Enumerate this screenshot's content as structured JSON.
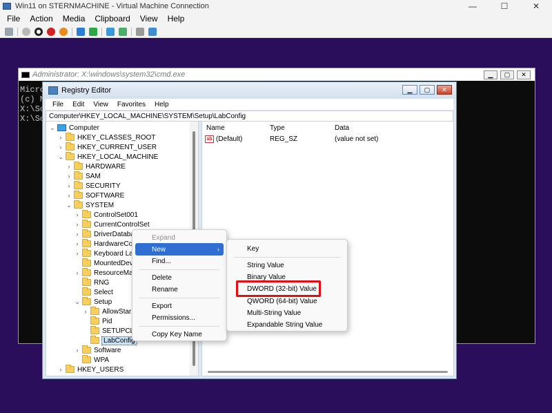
{
  "host": {
    "title": "Win11 on STERNMACHINE - Virtual Machine Connection",
    "menu": [
      "File",
      "Action",
      "Media",
      "Clipboard",
      "View",
      "Help"
    ],
    "window_buttons": [
      "—",
      "☐",
      "✕"
    ]
  },
  "cmd": {
    "title": "Administrator: X:\\windows\\system32\\cmd.exe",
    "lines": [
      "Micro",
      "(c) M",
      "",
      "X:\\So",
      "",
      "X:\\So"
    ]
  },
  "regedit": {
    "title": "Registry Editor",
    "menu": [
      "File",
      "Edit",
      "View",
      "Favorites",
      "Help"
    ],
    "address": "Computer\\HKEY_LOCAL_MACHINE\\SYSTEM\\Setup\\LabConfig",
    "tree": [
      {
        "arrow": "⌄",
        "label": "Computer",
        "icon": "pc"
      },
      {
        "arrow": "›",
        "label": "HKEY_CLASSES_ROOT",
        "icon": "folder"
      },
      {
        "arrow": "›",
        "label": "HKEY_CURRENT_USER",
        "icon": "folder"
      },
      {
        "arrow": "⌄",
        "label": "HKEY_LOCAL_MACHINE",
        "icon": "folder"
      },
      {
        "arrow": "›",
        "label": "HARDWARE",
        "icon": "folder"
      },
      {
        "arrow": "›",
        "label": "SAM",
        "icon": "folder"
      },
      {
        "arrow": "›",
        "label": "SECURITY",
        "icon": "folder"
      },
      {
        "arrow": "›",
        "label": "SOFTWARE",
        "icon": "folder"
      },
      {
        "arrow": "⌄",
        "label": "SYSTEM",
        "icon": "folder"
      },
      {
        "arrow": "›",
        "label": "ControlSet001",
        "icon": "folder"
      },
      {
        "arrow": "›",
        "label": "CurrentControlSet",
        "icon": "folder"
      },
      {
        "arrow": "›",
        "label": "DriverDataba",
        "icon": "folder"
      },
      {
        "arrow": "›",
        "label": "HardwareCo",
        "icon": "folder"
      },
      {
        "arrow": "›",
        "label": "Keyboard La",
        "icon": "folder"
      },
      {
        "arrow": "",
        "label": "MountedDev",
        "icon": "folder"
      },
      {
        "arrow": "›",
        "label": "ResourceMar",
        "icon": "folder"
      },
      {
        "arrow": "",
        "label": "RNG",
        "icon": "folder"
      },
      {
        "arrow": "",
        "label": "Select",
        "icon": "folder"
      },
      {
        "arrow": "⌄",
        "label": "Setup",
        "icon": "folder"
      },
      {
        "arrow": "›",
        "label": "AllowStar",
        "icon": "folder"
      },
      {
        "arrow": "",
        "label": "Pid",
        "icon": "folder"
      },
      {
        "arrow": "",
        "label": "SETUPCL",
        "icon": "folder"
      },
      {
        "arrow": "",
        "label": "LabConfig",
        "icon": "folder",
        "selected": true
      },
      {
        "arrow": "›",
        "label": "Software",
        "icon": "folder"
      },
      {
        "arrow": "",
        "label": "WPA",
        "icon": "folder"
      },
      {
        "arrow": "›",
        "label": "HKEY_USERS",
        "icon": "folder"
      }
    ],
    "list": {
      "headers": {
        "name": "Name",
        "type": "Type",
        "data": "Data"
      },
      "value": {
        "name": "(Default)",
        "type": "REG_SZ",
        "data": "(value not set)",
        "icon_text": "ab"
      }
    }
  },
  "context_menu": {
    "expand": "Expand",
    "new": "New",
    "new_arrow": "›",
    "find": "Find...",
    "delete": "Delete",
    "rename": "Rename",
    "export": "Export",
    "permissions": "Permissions...",
    "copy_key_name": "Copy Key Name"
  },
  "new_submenu": {
    "key": "Key",
    "string": "String Value",
    "binary": "Binary Value",
    "dword": "DWORD (32-bit) Value",
    "qword": "QWORD (64-bit) Value",
    "multi": "Multi-String Value",
    "expandable": "Expandable String Value"
  },
  "colors": {
    "desktop": "#2a0e5c",
    "menu_highlight": "#2f6fd3",
    "annotation_red": "#e01010"
  }
}
